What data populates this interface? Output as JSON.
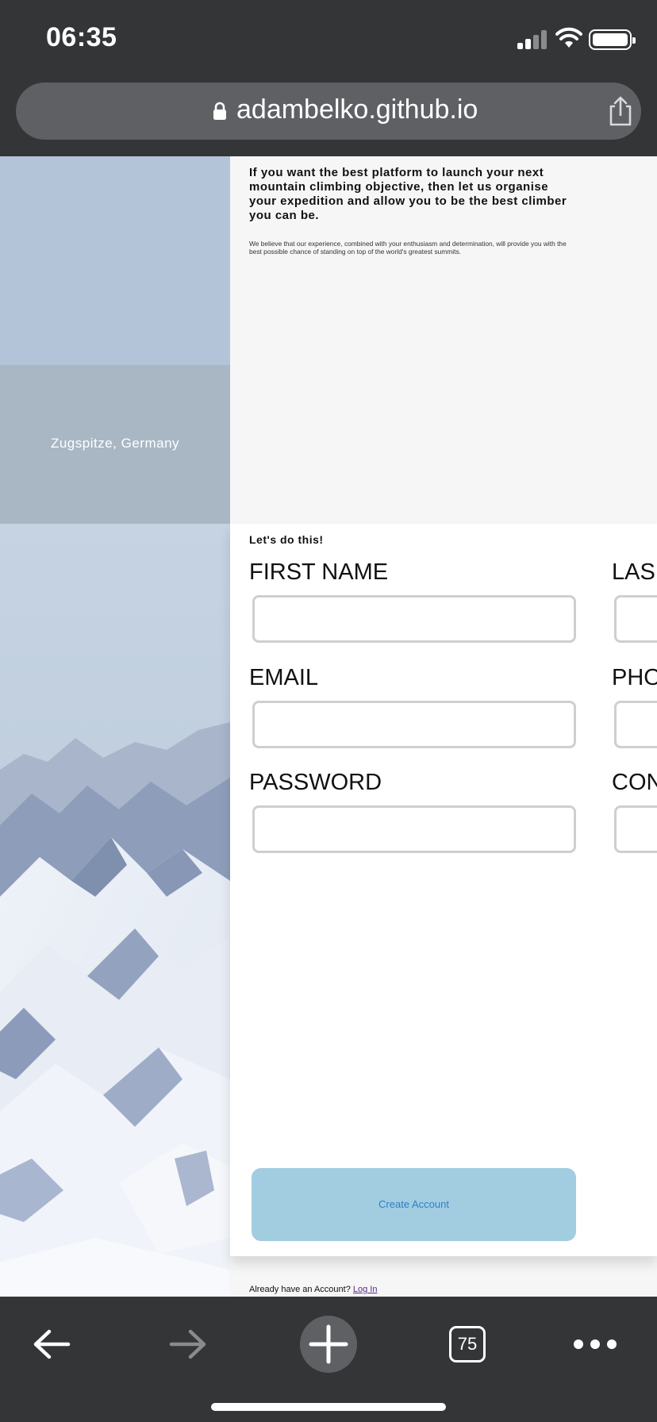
{
  "status_bar": {
    "time": "06:35",
    "icons": [
      "signal-icon",
      "wifi-icon",
      "battery-icon"
    ]
  },
  "address_bar": {
    "url": "adambelko.github.io",
    "icons": [
      "lock-icon",
      "share-icon"
    ]
  },
  "hero": {
    "caption": "Zugspitze, Germany",
    "headline": "If you want the best platform to launch your next mountain climbing objective, then let us organise your expedition and allow you to be the best climber you can be.",
    "subtext": "We believe that our experience, combined with your enthusiasm and determination, will provide you with the best possible chance of standing on top of the world's greatest summits."
  },
  "form": {
    "title": "Let's do this!",
    "fields": {
      "first_name": {
        "label": "FIRST NAME",
        "value": ""
      },
      "last_name": {
        "label": "LAS",
        "value": ""
      },
      "email": {
        "label": "EMAIL",
        "value": ""
      },
      "phone": {
        "label": "PHO",
        "value": ""
      },
      "password": {
        "label": "PASSWORD",
        "value": ""
      },
      "confirm": {
        "label": "CON",
        "value": ""
      }
    },
    "create_button": "Create Account",
    "login_prompt": "Already have an Account?",
    "login_link": "Log In"
  },
  "toolbar": {
    "tab_count": "75",
    "icons": [
      "back-arrow-icon",
      "forward-arrow-icon",
      "plus-icon",
      "tabs-icon",
      "more-icon"
    ]
  },
  "colors": {
    "chrome": "#343537",
    "url_pill": "#5e6064",
    "button_bg": "#a2cde1",
    "button_text": "#2f7fc9",
    "link": "#5a2a8a"
  }
}
